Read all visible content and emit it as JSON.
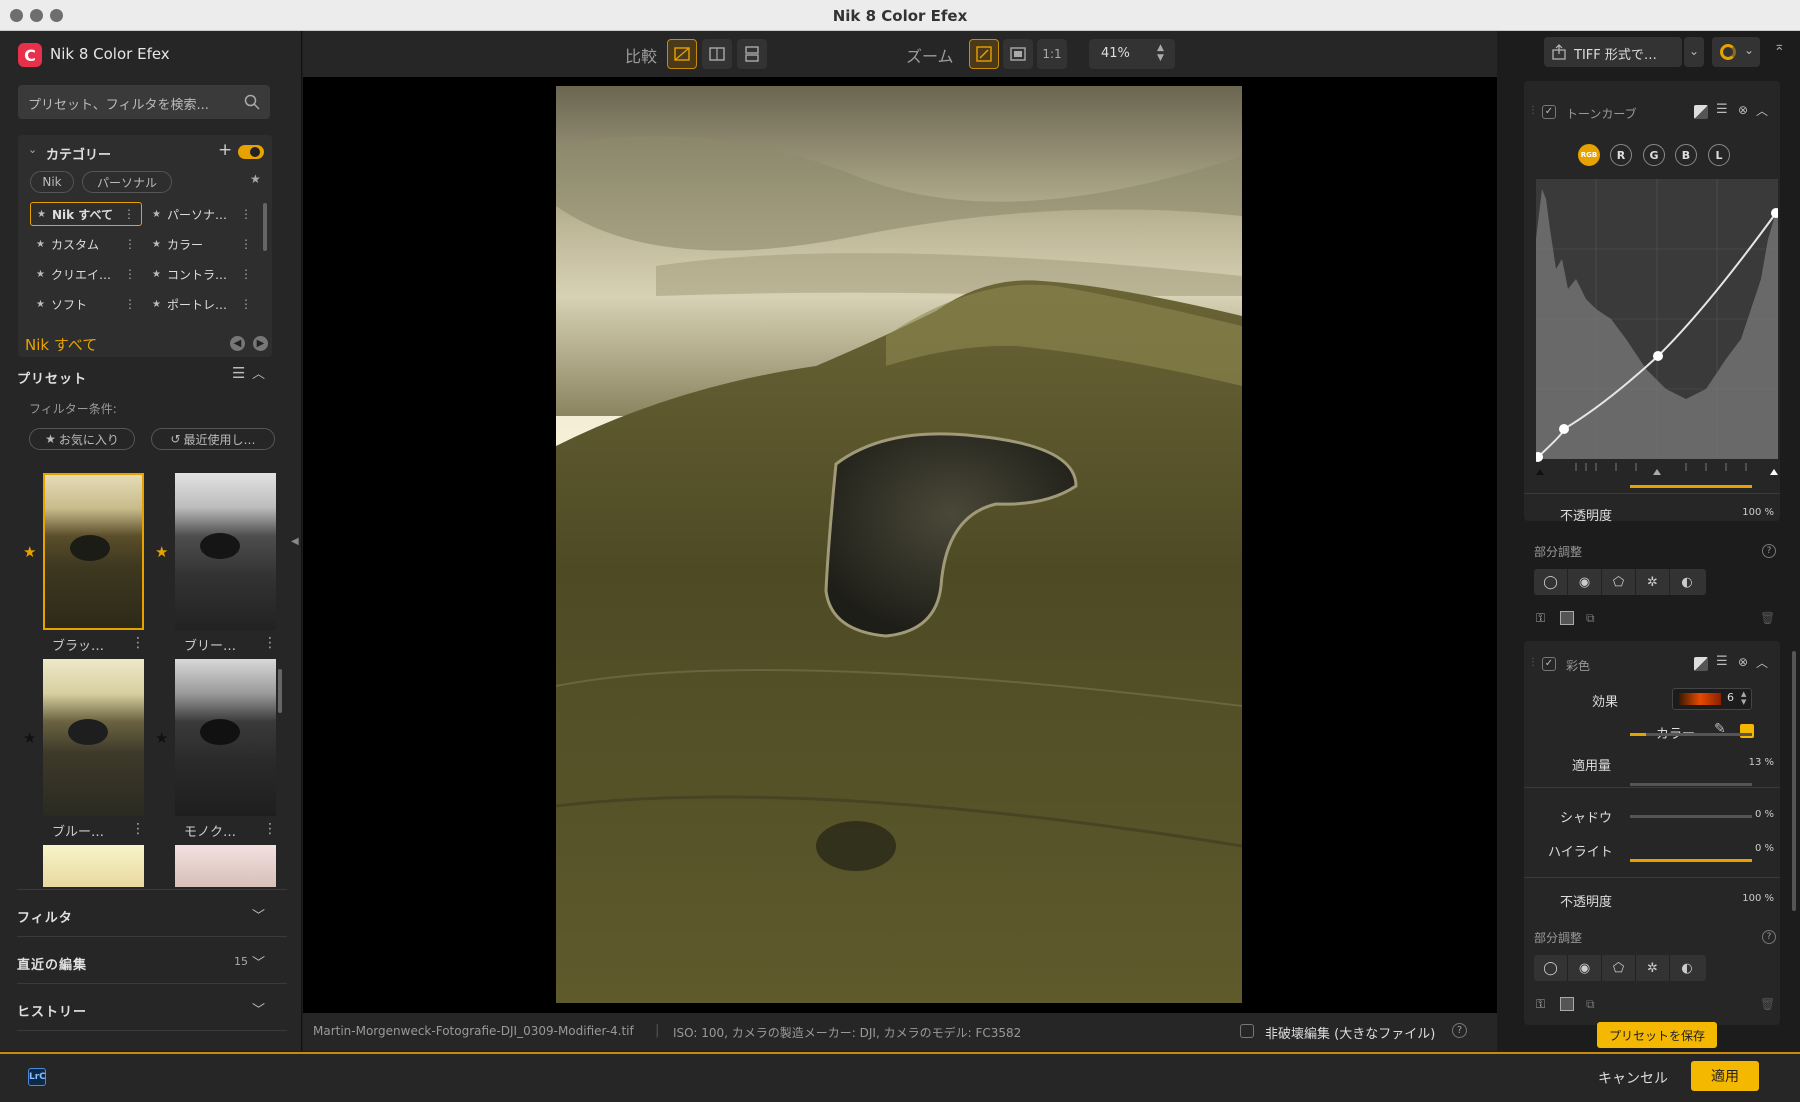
{
  "window": {
    "title": "Nik 8 Color Efex"
  },
  "app": {
    "name": "Nik 8 Color Efex"
  },
  "search": {
    "placeholder": "プリセット、フィルタを検索..."
  },
  "category": {
    "title": "カテゴリー",
    "chips": [
      "Nik",
      "パーソナル"
    ],
    "items": [
      {
        "label": "Nik すべて",
        "selected": true
      },
      {
        "label": "パーソナ…",
        "selected": false
      },
      {
        "label": "カスタム",
        "selected": false
      },
      {
        "label": "カラー",
        "selected": false
      },
      {
        "label": "クリエイ…",
        "selected": false
      },
      {
        "label": "コントラ…",
        "selected": false
      },
      {
        "label": "ソフト",
        "selected": false
      },
      {
        "label": "ポートレ…",
        "selected": false
      }
    ]
  },
  "current_category": "Nik すべて",
  "presets": {
    "title": "プリセット",
    "filter_label": "フィルター条件:",
    "filter_chips": [
      "お気に入り",
      "最近使用し…"
    ],
    "thumbs": [
      {
        "label": "ブラッ…"
      },
      {
        "label": "ブリー…"
      },
      {
        "label": "ブルー…"
      },
      {
        "label": "モノク…"
      }
    ]
  },
  "sections": {
    "filter": "フィルタ",
    "recent": "直近の編集",
    "recent_count": "15",
    "history": "ヒストリー"
  },
  "toolbar": {
    "compare_label": "比較",
    "zoom_label": "ズーム",
    "zoom_1to1": "1:1",
    "zoom_value": "41%"
  },
  "statusbar": {
    "filename": "Martin-Morgenweck-Fotografie-DJI_0309-Modifier-4.tif",
    "meta": "ISO: 100, カメラの製造メーカー: DJI, カメラのモデル: FC3582",
    "nondestructive": "非破壊編集 (大きなファイル)"
  },
  "export": {
    "label": "TIFF 形式で…"
  },
  "tonecurve": {
    "title": "トーンカーブ",
    "channels": [
      "RGB",
      "R",
      "G",
      "B",
      "L"
    ],
    "opacity_label": "不透明度",
    "opacity_value": "100 %",
    "opacity_level": 1.0,
    "partial_label": "部分調整"
  },
  "colorize": {
    "title": "彩色",
    "effect_label": "効果",
    "effect_value": "6",
    "color_label": "カラー",
    "color": "#f5b800",
    "amount_label": "適用量",
    "amount_value": "13 %",
    "amount_level": 0.13,
    "shadow_label": "シャドウ",
    "shadow_value": "0 %",
    "highlight_label": "ハイライト",
    "highlight_value": "0 %",
    "opacity_label": "不透明度",
    "opacity_value": "100 %",
    "partial_label": "部分調整"
  },
  "save_preset": "プリセットを保存",
  "footer": {
    "lrc": "LrC",
    "cancel": "キャンセル",
    "apply": "適用"
  },
  "colors": {
    "accent": "#e8a200",
    "panel": "#262626"
  }
}
